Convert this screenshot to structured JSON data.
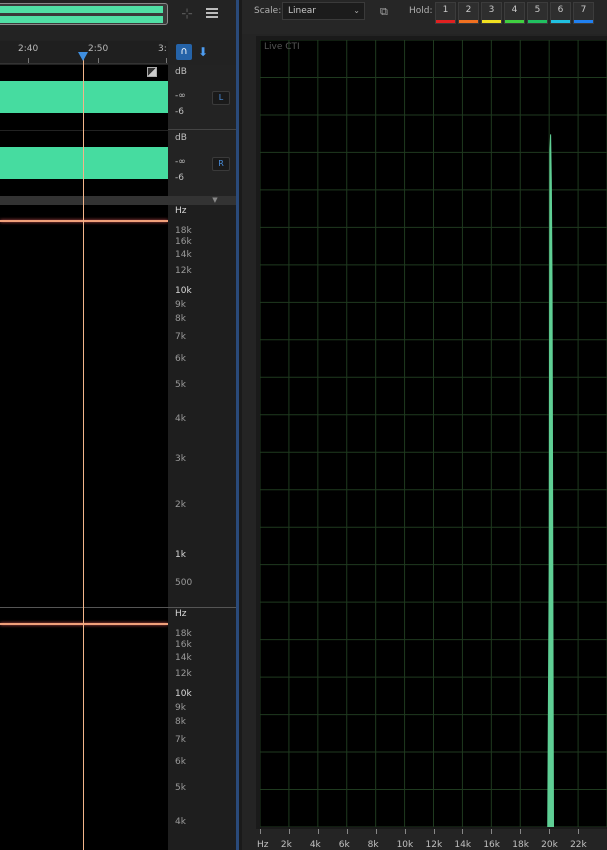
{
  "editor": {
    "time_ruler": [
      "2:40",
      "2:50",
      "3:"
    ],
    "channels": [
      {
        "db_label": "dB",
        "db_marks": [
          "-∞",
          "-6"
        ],
        "button": "L"
      },
      {
        "db_label": "dB",
        "db_marks": [
          "-∞",
          "-6"
        ],
        "button": "R"
      }
    ],
    "spectral_top": {
      "unit": "Hz",
      "labels": [
        "18k",
        "16k",
        "14k",
        "12k",
        "10k",
        "9k",
        "8k",
        "7k",
        "6k",
        "5k",
        "4k",
        "3k",
        "2k",
        "1k",
        "500"
      ]
    },
    "spectral_bottom": {
      "unit": "Hz",
      "labels": [
        "18k",
        "16k",
        "14k",
        "12k",
        "10k",
        "9k",
        "8k",
        "7k",
        "6k",
        "5k",
        "4k"
      ]
    },
    "colors": {
      "waveform": "#46dca0",
      "cursor": "#f3b58a",
      "playhead": "#3f8fe0"
    }
  },
  "analysis": {
    "scale_label": "Scale:",
    "scale_value": "Linear",
    "hold_label": "Hold:",
    "hold_buttons": [
      {
        "label": "1",
        "color": "#e02020"
      },
      {
        "label": "2",
        "color": "#f07020"
      },
      {
        "label": "3",
        "color": "#f0e020"
      },
      {
        "label": "4",
        "color": "#40d040"
      },
      {
        "label": "5",
        "color": "#20c060"
      },
      {
        "label": "6",
        "color": "#20c0e0"
      },
      {
        "label": "7",
        "color": "#2080f0"
      }
    ],
    "live_label": "Live CTI",
    "x_axis": [
      "Hz",
      "2k",
      "4k",
      "6k",
      "8k",
      "10k",
      "12k",
      "14k",
      "16k",
      "18k",
      "20k",
      "22k"
    ],
    "peak_color": "#5fcf95"
  },
  "chart_data": {
    "type": "bar",
    "xlabel": "Hz",
    "ylabel": "",
    "xlim": [
      0,
      24000
    ],
    "ylim": [
      0,
      1
    ],
    "grid": true,
    "points": [
      {
        "x": 19900,
        "y": 0.0
      },
      {
        "x": 20000,
        "y": 0.33
      },
      {
        "x": 20050,
        "y": 0.86
      },
      {
        "x": 20100,
        "y": 0.88
      },
      {
        "x": 20150,
        "y": 0.82
      },
      {
        "x": 20200,
        "y": 0.69
      },
      {
        "x": 20300,
        "y": 0.0
      }
    ]
  }
}
